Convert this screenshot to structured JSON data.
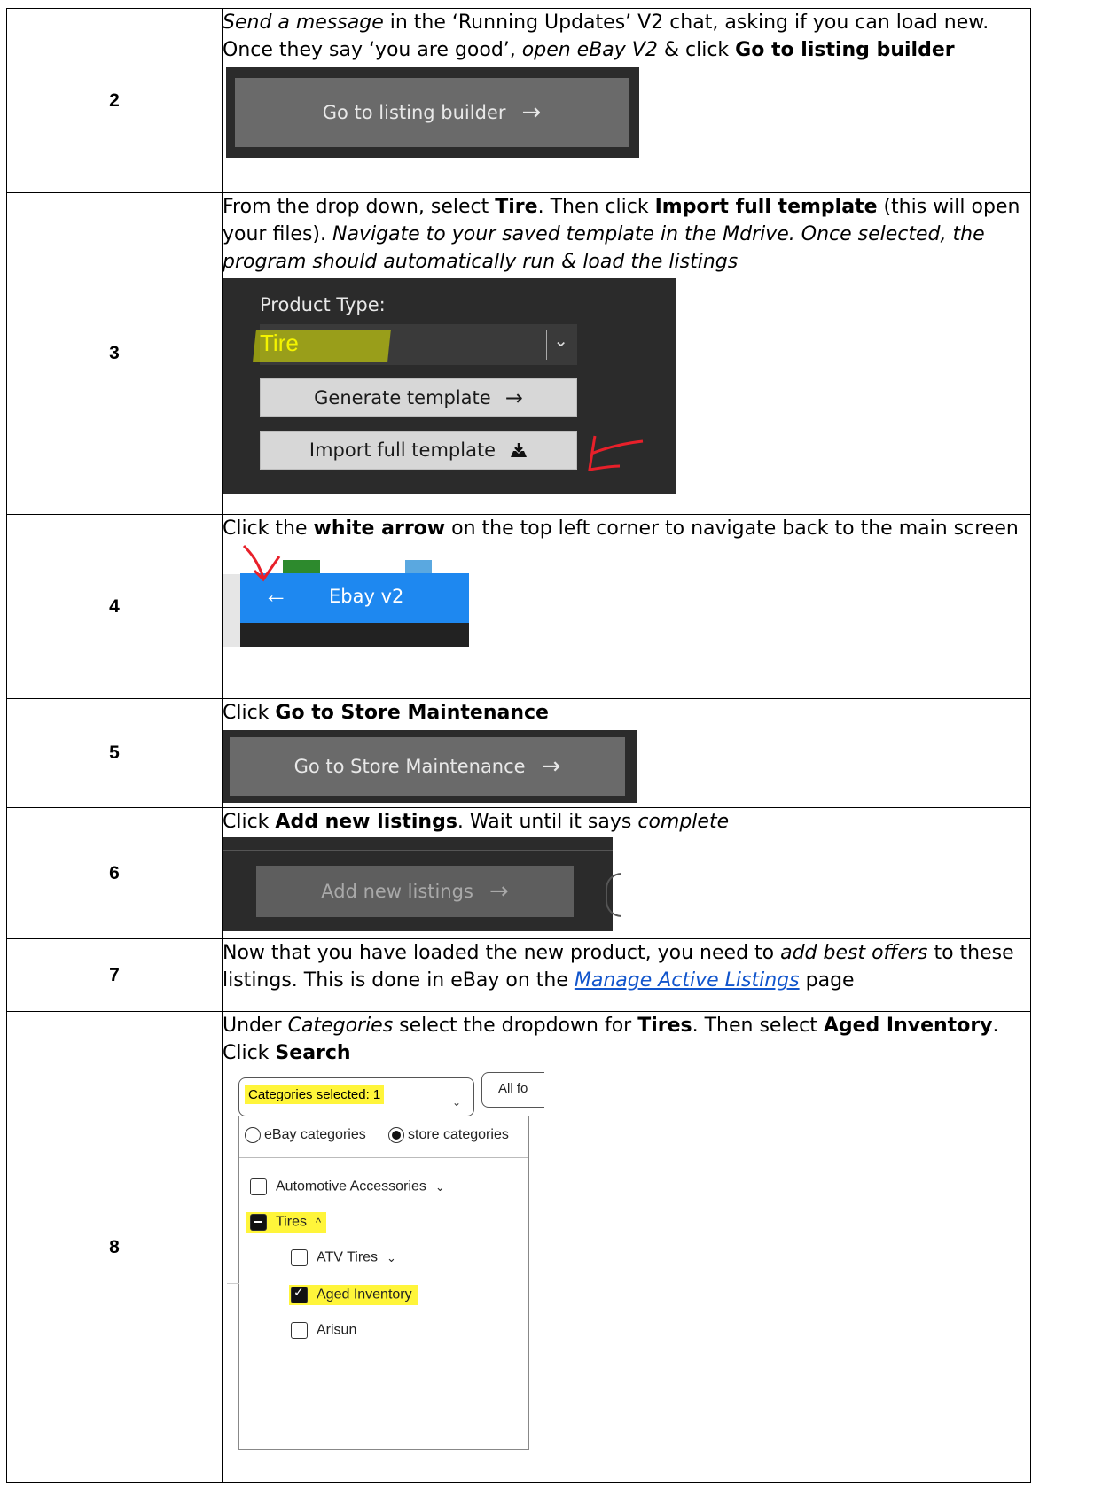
{
  "steps": [
    {
      "number": "2",
      "parts": {
        "a": "Send a message",
        "b": " in the ‘Running Updates’ V2 chat, asking if you can load new. Once they say ‘you are good’, ",
        "c": "open eBay V2",
        "d": " & click ",
        "e": "Go to listing builder"
      },
      "button_label": "Go to listing builder"
    },
    {
      "number": "3",
      "parts": {
        "a": "From the drop down, select ",
        "b": "Tire",
        "c": ". Then click ",
        "d": "Import full template",
        "e": " (this will open your files). ",
        "f": "Navigate to your saved template in the Mdrive. Once selected, the program should automatically run & load the listings"
      },
      "product_type_label": "Product Type:",
      "product_type_value": "Tire",
      "generate_label": "Generate template",
      "import_label": "Import full template"
    },
    {
      "number": "4",
      "parts": {
        "a": "Click the ",
        "b": "white arrow",
        "c": " on the top left corner to navigate back to the main screen"
      },
      "window_title": "Ebay v2"
    },
    {
      "number": "5",
      "parts": {
        "a": "Click ",
        "b": "Go to Store Maintenance"
      },
      "button_label": "Go to Store Maintenance"
    },
    {
      "number": "6",
      "parts": {
        "a": "Click ",
        "b": "Add new listings",
        "c": ". Wait until it says ",
        "d": "complete"
      },
      "button_label": "Add new listings"
    },
    {
      "number": "7",
      "parts": {
        "a": "Now that you have loaded the new product, you need to ",
        "b": "add best offers",
        "c": " to these listings. This is done in eBay on the ",
        "d": "Manage Active Listings",
        "e": " page"
      }
    },
    {
      "number": "8",
      "parts": {
        "a": "Under ",
        "b": "Categories",
        "c": " select the dropdown for ",
        "d": "Tires",
        "e": ". Then select ",
        "f": "Aged Inventory",
        "g": ". Click ",
        "h": "Search"
      },
      "categories_selected": "Categories selected: 1",
      "all_formats": "All fo",
      "ebay_categories": "eBay categories",
      "store_categories": "store categories",
      "list": {
        "automotive": "Automotive Accessories",
        "tires": "Tires",
        "atv": "ATV Tires",
        "aged": "Aged Inventory",
        "arisun": "Arisun"
      }
    }
  ],
  "colors": {
    "dark_panel": "#2b2b2b",
    "button_gray": "#6a6a6a",
    "ebay_blue": "#1e88f0",
    "highlight": "#fff53a",
    "annotation_red": "#e8202a"
  }
}
